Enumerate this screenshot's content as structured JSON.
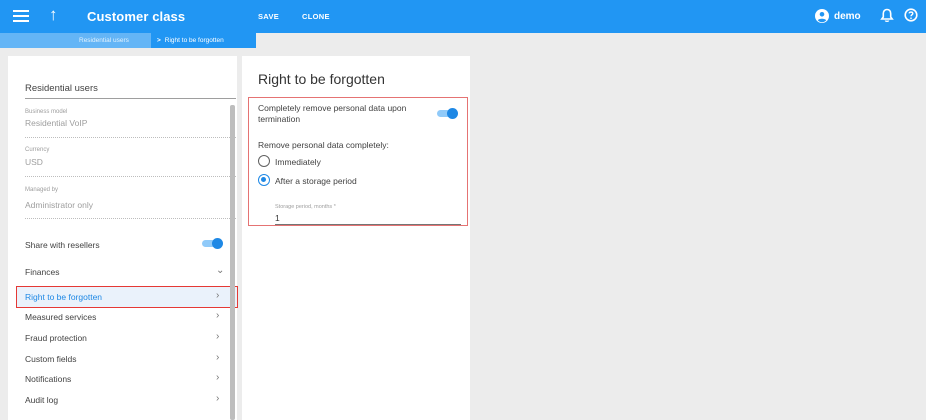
{
  "header": {
    "title": "Customer class",
    "save_label": "SAVE",
    "clone_label": "CLONE",
    "user_name": "demo",
    "icons": [
      "menu-icon",
      "arrow-up-icon",
      "account-icon",
      "bell-icon",
      "help-icon"
    ],
    "accent_color": "#2196f3"
  },
  "breadcrumb": {
    "items": [
      "Residential users",
      "Right to be forgotten"
    ]
  },
  "sidebar": {
    "name": "Residential users",
    "fields": [
      {
        "label": "Business model",
        "value": "Residential VoIP"
      },
      {
        "label": "Currency",
        "value": "USD"
      },
      {
        "label": "Managed by",
        "value": "Administrator only"
      }
    ],
    "share_label": "Share with resellers",
    "share_enabled": true,
    "menu": [
      {
        "label": "Finances",
        "chevron": "chevron-down-icon"
      },
      {
        "label": "Right to be forgotten",
        "chevron": "chevron-right-icon",
        "active": true
      },
      {
        "label": "Measured services",
        "chevron": "chevron-right-icon"
      },
      {
        "label": "Fraud protection",
        "chevron": "chevron-right-icon"
      },
      {
        "label": "Custom fields",
        "chevron": "chevron-right-icon"
      },
      {
        "label": "Notifications",
        "chevron": "chevron-right-icon"
      },
      {
        "label": "Audit log",
        "chevron": "chevron-right-icon"
      }
    ]
  },
  "rtbf": {
    "title": "Right to be forgotten",
    "remove_label": "Completely remove personal data upon termination",
    "remove_enabled": true,
    "subtitle": "Remove personal data completely:",
    "options": [
      {
        "label": "Immediately",
        "checked": false
      },
      {
        "label": "After a storage period",
        "checked": true
      }
    ],
    "storage_label": "Storage period, months *",
    "storage_value": "1"
  }
}
